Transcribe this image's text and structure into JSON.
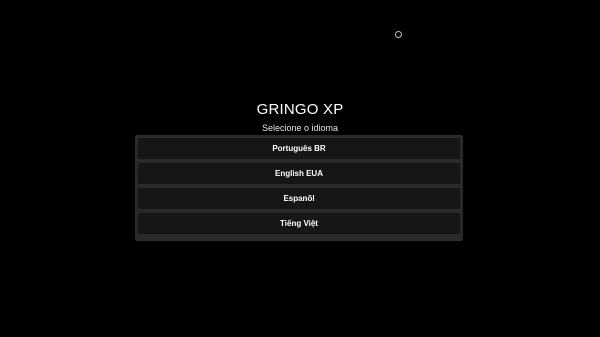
{
  "app": {
    "title": "GRINGO XP",
    "subtitle": "Selecione o idioma"
  },
  "icons": {
    "loading": "loading-ring-icon"
  },
  "languages": [
    {
      "label": "Português BR"
    },
    {
      "label": "English EUA"
    },
    {
      "label": "Espanõl"
    },
    {
      "label": "Tiếng Việt"
    }
  ],
  "colors": {
    "background": "#000000",
    "panel": "#2a2a2a",
    "option": "#161616",
    "text": "#ffffff"
  }
}
